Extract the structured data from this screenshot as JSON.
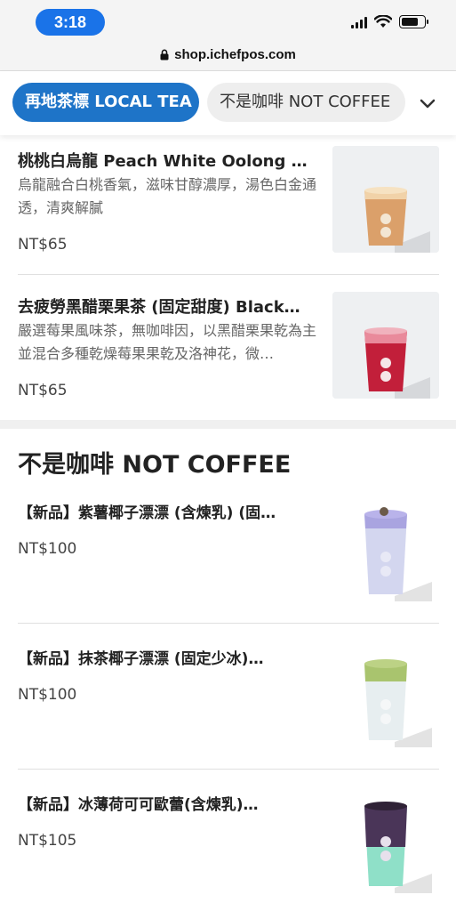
{
  "status_bar": {
    "time": "3:18"
  },
  "browser": {
    "url": "shop.ichefpos.com"
  },
  "tabs": [
    {
      "label": "再地茶標 LOCAL TEA",
      "active": true
    },
    {
      "label": "不是咖啡 NOT COFFEE",
      "active": false
    }
  ],
  "local_tea_items": [
    {
      "name": "桃桃白烏龍 Peach White Oolong Tea",
      "description": "烏龍融合白桃香氣，滋味甘醇濃厚，湯色白金通透，清爽解膩",
      "price": "NT$65"
    },
    {
      "name": "去疲勞黑醋栗果茶 (固定甜度) Black…",
      "description": "嚴選莓果風味茶，無咖啡因，以黑醋栗果乾為主並混合多種乾燥莓果果乾及洛神花，微…",
      "price": "NT$65"
    }
  ],
  "not_coffee_section": {
    "title": "不是咖啡 NOT COFFEE",
    "items": [
      {
        "name": "【新品】紫薯椰子漂漂 (含煉乳) (固…",
        "price": "NT$100"
      },
      {
        "name": "【新品】抹茶椰子漂漂 (固定少冰)…",
        "price": "NT$100"
      },
      {
        "name": "【新品】冰薄荷可可歐蕾(含煉乳)…",
        "price": "NT$105"
      }
    ]
  },
  "colors": {
    "accent": "#1e74c8",
    "time_pill": "#1a73e8"
  }
}
